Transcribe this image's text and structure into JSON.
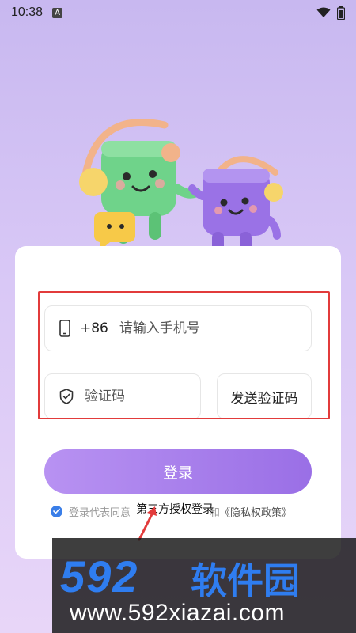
{
  "status_bar": {
    "time": "10:38",
    "notification_letter": "A"
  },
  "login": {
    "country_code": "+86",
    "phone_placeholder": "请输入手机号",
    "code_placeholder": "验证码",
    "send_code_label": "发送验证码",
    "login_label": "登录",
    "agreement_text": "登录代表同意",
    "agreement_suffix": "和",
    "privacy_link": "《隐私权政策》",
    "third_party_label": "第三方授权登录"
  },
  "watermark": {
    "brand_number": "592",
    "brand_cn": "软件园",
    "url": "www.592xiazai.com"
  },
  "colors": {
    "accent": "#9a6fe6",
    "check": "#3a7ee8",
    "highlight": "#e23b3b",
    "watermark_blue": "#2f7df0"
  },
  "icons": [
    "wifi-icon",
    "battery-icon",
    "phone-icon",
    "shield-icon",
    "check-icon",
    "arrow-icon"
  ]
}
